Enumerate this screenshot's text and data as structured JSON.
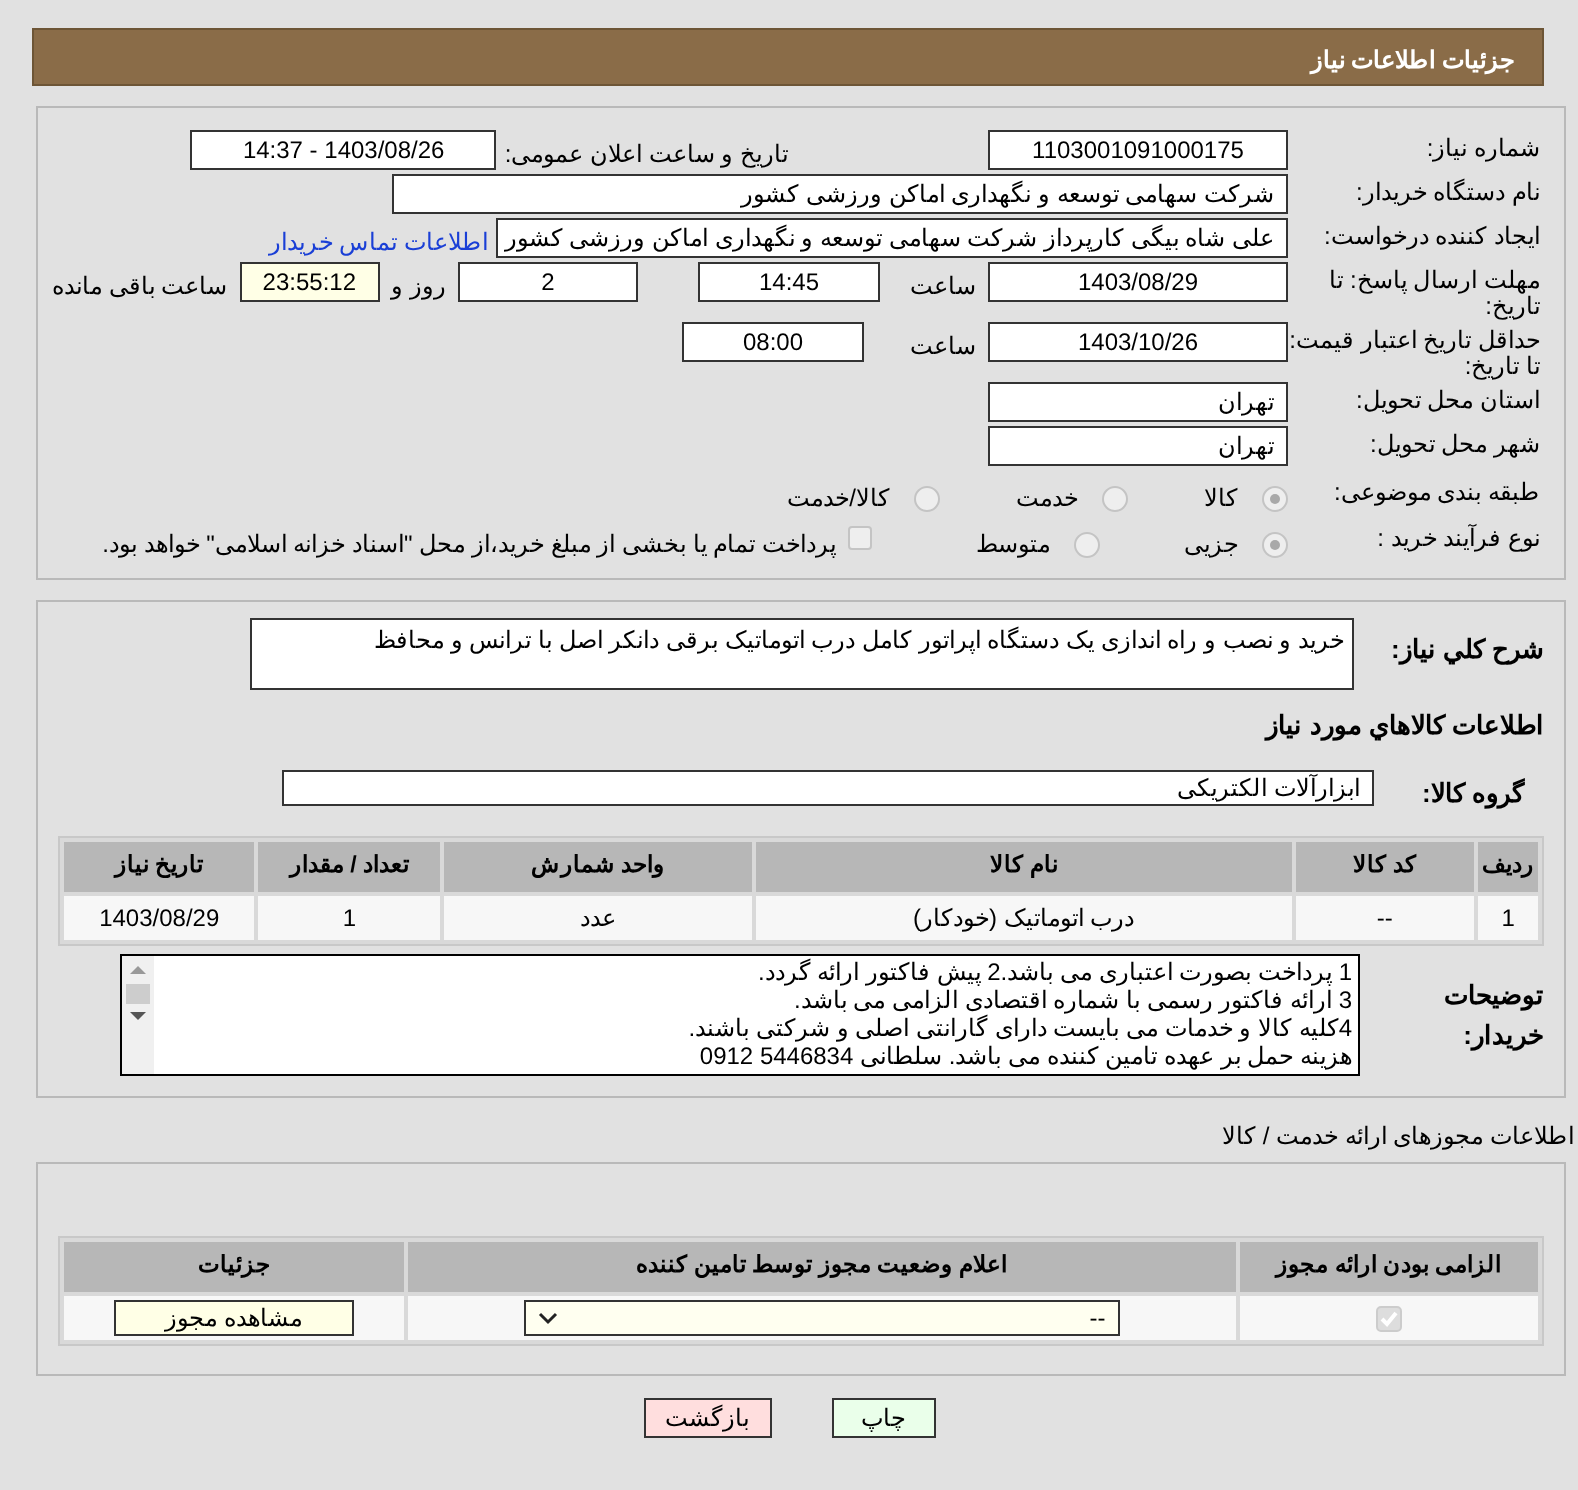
{
  "header": {
    "title": "جزئیات اطلاعات نیاز"
  },
  "need_info": {
    "need_number": {
      "label": "شماره نیاز:",
      "value": "1103001091000175"
    },
    "announce": {
      "label": "تاریخ و ساعت اعلان عمومی:",
      "value": "1403/08/26 - 14:37"
    },
    "buyer_org": {
      "label": "نام دستگاه خریدار:",
      "value": "شرکت سهامی توسعه و نگهداری اماکن ورزشی کشور"
    },
    "requester": {
      "label": "ایجاد کننده درخواست:",
      "value": "علی شاه بیگی کارپرداز شرکت سهامی توسعه و نگهداری اماکن ورزشی کشور",
      "link": "اطلاعات تماس خریدار"
    },
    "reply_deadline": {
      "label": "مهلت ارسال پاسخ: تا تاریخ:",
      "date": "1403/08/29",
      "time_label": "ساعت",
      "time": "14:45",
      "days": "2",
      "days_label": "روز و",
      "remaining": "23:55:12",
      "remaining_label": "ساعت باقی مانده"
    },
    "price_validity": {
      "label": "حداقل تاریخ اعتبار قیمت: تا تاریخ:",
      "date": "1403/10/26",
      "time_label": "ساعت",
      "time": "08:00"
    },
    "province": {
      "label": "استان محل تحویل:",
      "value": "تهران"
    },
    "city": {
      "label": "شهر محل تحویل:",
      "value": "تهران"
    },
    "category": {
      "label": "طبقه بندی موضوعی:",
      "options": [
        {
          "label": "کالا",
          "selected": true
        },
        {
          "label": "خدمت",
          "selected": false
        },
        {
          "label": "کالا/خدمت",
          "selected": false
        }
      ]
    },
    "process": {
      "label": "نوع فرآیند خرید :",
      "options": [
        {
          "label": "جزیی",
          "selected": true
        },
        {
          "label": "متوسط",
          "selected": false
        }
      ],
      "treasury": {
        "label": "پرداخت تمام یا بخشی از مبلغ خرید،از محل \"اسناد خزانه اسلامی\" خواهد بود.",
        "checked": false
      }
    }
  },
  "goods": {
    "description": {
      "label": "شرح کلي نياز:",
      "value": "خرید و نصب و راه اندازی یک دستگاه اپراتور کامل درب اتوماتیک برقی دانکر اصل با ترانس و محافظ"
    },
    "section_title": "اطلاعات کالاهاي مورد نياز",
    "group": {
      "label": "گروه کالا:",
      "value": "ابزارآلات الکتریکی"
    },
    "table": {
      "columns": [
        "ردیف",
        "کد کالا",
        "نام کالا",
        "واحد شمارش",
        "تعداد / مقدار",
        "تاریخ نیاز"
      ],
      "rows": [
        [
          "1",
          "--",
          "درب اتوماتیک (خودکار)",
          "عدد",
          "1",
          "1403/08/29"
        ]
      ]
    },
    "notes": {
      "label": "توضیحات خریدار:",
      "lines": [
        "1 پرداخت بصورت اعتباری می باشد.2 پیش فاکتور ارائه گردد.",
        "3 ارائه فاکتور رسمی با شماره اقتصادی الزامی می باشد.",
        "4کلیه کالا و خدمات می بایست دارای گارانتی اصلی و شرکتی باشند.",
        "هزینه حمل بر عهده تامین کننده می باشد. سلطانی 5446834   0912"
      ]
    }
  },
  "permits": {
    "title": "اطلاعات مجوزهای ارائه خدمت / کالا",
    "columns": [
      "الزامی بودن ارائه مجوز",
      "اعلام وضعیت مجوز توسط تامین کننده",
      "جزئیات"
    ],
    "rows": [
      {
        "required": true,
        "status": "--",
        "action": "مشاهده مجوز"
      }
    ]
  },
  "buttons": [
    {
      "kind": "print",
      "label": "چاپ"
    },
    {
      "kind": "back",
      "label": "بازگشت"
    }
  ]
}
